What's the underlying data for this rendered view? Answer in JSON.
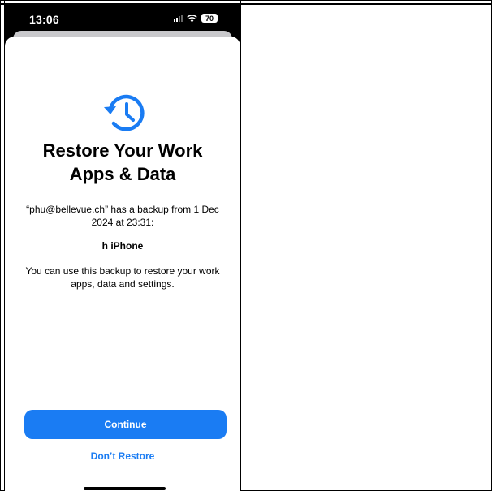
{
  "status_bar": {
    "time": "13:06",
    "battery": "70",
    "icons": [
      "signal-icon",
      "wifi-icon",
      "battery-icon"
    ]
  },
  "sheet": {
    "icon": "restore-history-icon",
    "title_line1": "Restore Your Work",
    "title_line2": "Apps & Data",
    "description": "“phu@bellevue.ch” has a backup from 1 Dec 2024 at 23:31:",
    "device_name": "h iPhone",
    "description2": "You can use this backup to restore your work apps, data and settings.",
    "continue_label": "Continue",
    "dont_restore_label": "Don’t Restore"
  },
  "colors": {
    "accent": "#1a7cf3",
    "status_bar_bg": "#000000",
    "sheet_bg": "#ffffff"
  }
}
